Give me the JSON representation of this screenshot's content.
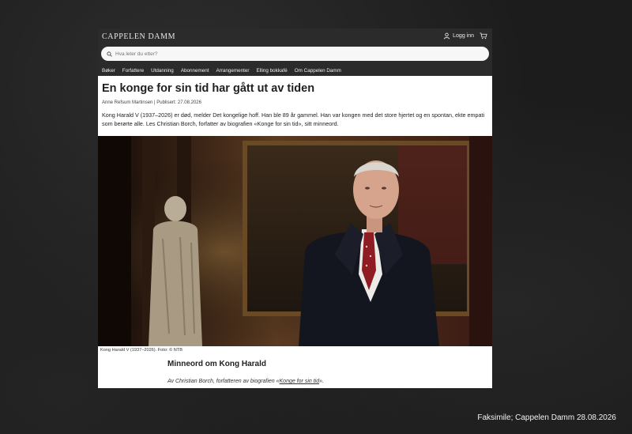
{
  "header": {
    "logo": "CAPPELEN DAMM",
    "login_label": "Logg inn",
    "icons": [
      "user-icon",
      "cart-icon"
    ]
  },
  "search": {
    "placeholder": "Hva leter du etter?",
    "icon": "search-icon"
  },
  "nav": {
    "items": [
      "Bøker",
      "Forfattere",
      "Utdanning",
      "Abonnement",
      "Arrangementer",
      "Elling bokkafé",
      "Om Cappelen Damm"
    ]
  },
  "article": {
    "title": "En konge for sin tid har gått ut av tiden",
    "byline": "Anne Refsum Martinsen | Publisert: 27.08.2026",
    "lead": "Kong Harald V (1937–2026) er død, melder Det kongelige hoff. Han ble 89 år gammel. Han var kongen med det store hjertet og en spontan, ekte empati som berørte alle. Les Christian Borch, forfatter av biografien «Konge for sin tid», sitt minneord.",
    "photo_caption": "Kong Harald V (1937–2026). Foto: © NTB",
    "subheading": "Minneord om Kong Harald",
    "author_prefix": "Av Christian Borch, forfatteren av biografien «",
    "author_link": "Konge for sin tid",
    "author_suffix": "»."
  },
  "footer_note": "Faksimile; Cappelen Damm 28.08.2026"
}
